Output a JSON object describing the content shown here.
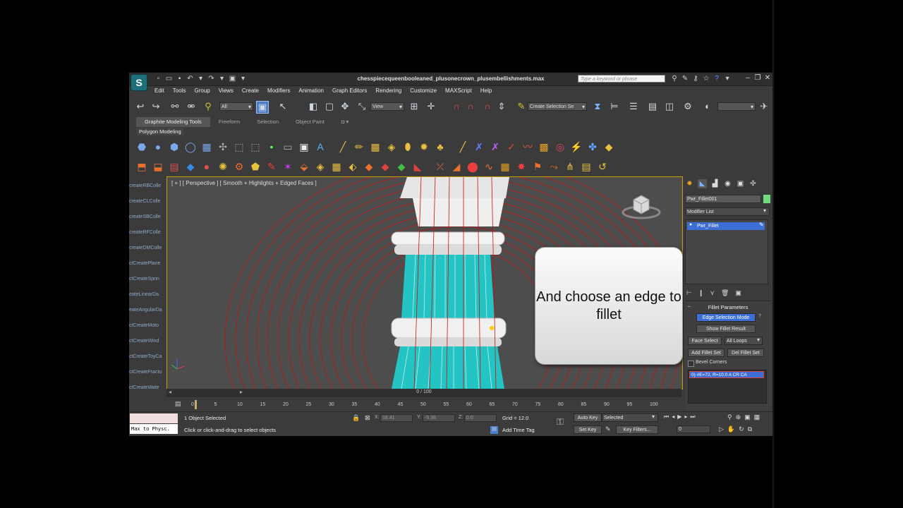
{
  "window": {
    "title": "chesspiecequeenbooleaned_plusonecrown_plusembellishments.max",
    "search_placeholder": "Type a keyword or phrase",
    "logo": "S"
  },
  "menu": [
    "Edit",
    "Tools",
    "Group",
    "Views",
    "Create",
    "Modifiers",
    "Animation",
    "Graph Editors",
    "Rendering",
    "Customize",
    "MAXScript",
    "Help"
  ],
  "toolbar": {
    "filter_value": "All",
    "view_value": "View",
    "selection_set_placeholder": "Create Selection Se"
  },
  "ribbon": {
    "tabs": [
      "Graphite Modeling Tools",
      "Freeform",
      "Selection",
      "Object Paint"
    ],
    "panel_label": "Polygon Modeling"
  },
  "left_panel_items": [
    "createRBColle",
    "createCLColle",
    "createSBColle",
    "createRFColle",
    "createDMColle",
    "ctCreatePlane",
    "ctCreateSprin",
    "eateLinearDa",
    "eateAngularDa",
    "ctCreateMoto",
    "ctCreateWind",
    "ctCreateToyCa",
    "ctCreateFractu",
    "ctCreateWate"
  ],
  "viewport": {
    "label": "[ + ] [ Perspective ] [ Smooth + Highlights + Edged Faces ]",
    "callout": "And choose an edge to fillet"
  },
  "timeline": {
    "position": "0 / 100",
    "ticks": [
      "0",
      "5",
      "10",
      "15",
      "20",
      "25",
      "30",
      "35",
      "40",
      "45",
      "50",
      "55",
      "60",
      "65",
      "70",
      "75",
      "80",
      "85",
      "90",
      "95",
      "100"
    ]
  },
  "command_panel": {
    "object_name": "Pwr_Fillet001",
    "object_color": "#6fdc7f",
    "modifier_list": "Modifier List",
    "stack_item": "Pwr_Fillet",
    "rollout_title": "Fillet Parameters",
    "edge_selection_mode": "Edge Selection Mode",
    "show_fillet_result": "Show Fillet Result",
    "face_select": "Face Select",
    "all_loops": "All Loops",
    "add_fillet_set": "Add Fillet Set",
    "del_fillet_set": "Del Fillet Set",
    "bevel_corners": "Bevel Corners",
    "fillet_set_entry": "0) #E=72, R=10.0 A CR CA"
  },
  "status": {
    "script_listener": "Max to Physc.",
    "objects_selected": "1 Object Selected",
    "prompt": "Click or click-and-drag to select objects",
    "x_label": "X:",
    "x_value": "18.41",
    "y_label": "Y:",
    "y_value": "-5.36",
    "z_label": "Z:",
    "z_value": "0.0",
    "grid": "Grid = 12.0",
    "add_time_tag": "Add Time Tag",
    "auto_key": "Auto Key",
    "set_key": "Set Key",
    "selected": "Selected",
    "key_filters": "Key Filters...",
    "frame": "0"
  },
  "colors": {
    "accent": "#3c6fd6",
    "viewport_border": "#c8a000",
    "wire": "#c81010",
    "selected_faces": "#25c4c4"
  }
}
